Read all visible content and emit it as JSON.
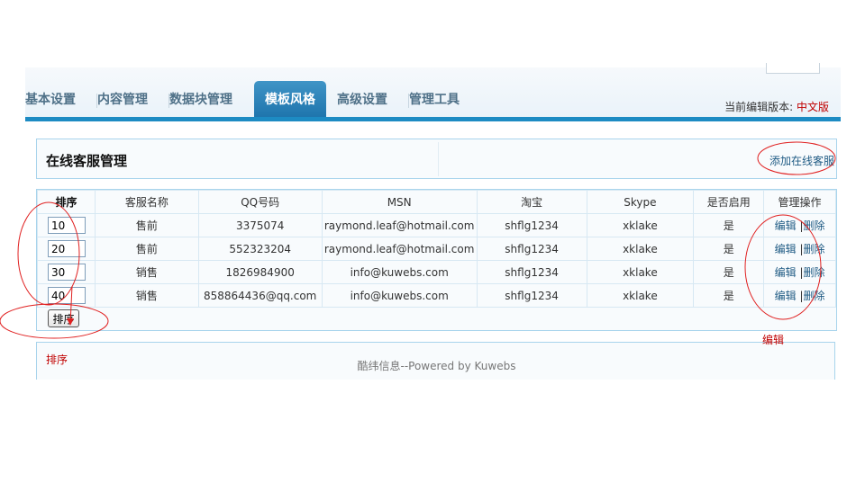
{
  "nav": {
    "items": [
      {
        "label": "基本设置",
        "active": false
      },
      {
        "label": "内容管理",
        "active": false
      },
      {
        "label": "数据块管理",
        "active": false
      },
      {
        "label": "模板风格",
        "active": true
      },
      {
        "label": "高级设置",
        "active": false
      },
      {
        "label": "管理工具",
        "active": false
      }
    ],
    "version_label": "当前编辑版本:",
    "version_value": "中文版"
  },
  "page": {
    "title": "在线客服管理",
    "add_link": "添加在线客服"
  },
  "table": {
    "headers": [
      "排序",
      "客服名称",
      "QQ号码",
      "MSN",
      "淘宝",
      "Skype",
      "是否启用",
      "管理操作"
    ],
    "rows": [
      {
        "order": "10",
        "name": "售前",
        "qq": "3375074",
        "msn": "raymond.leaf@hotmail.com",
        "taobao": "shflg1234",
        "skype": "xklake",
        "enabled": "是",
        "edit": "编辑",
        "sep": "|",
        "delete": "删除"
      },
      {
        "order": "20",
        "name": "售前",
        "qq": "552323204",
        "msn": "raymond.leaf@hotmail.com",
        "taobao": "shflg1234",
        "skype": "xklake",
        "enabled": "是",
        "edit": "编辑",
        "sep": "|",
        "delete": "删除"
      },
      {
        "order": "30",
        "name": "销售",
        "qq": "1826984900",
        "msn": "info@kuwebs.com",
        "taobao": "shflg1234",
        "skype": "xklake",
        "enabled": "是",
        "edit": "编辑",
        "sep": "|",
        "delete": "删除"
      },
      {
        "order": "40",
        "name": "销售",
        "qq": "858864436@qq.com",
        "msn": "info@kuwebs.com",
        "taobao": "shflg1234",
        "skype": "xklake",
        "enabled": "是",
        "edit": "编辑",
        "sep": "|",
        "delete": "删除"
      }
    ],
    "sort_button": "排序"
  },
  "footer": {
    "copyright": "酷纬信息--Powered by Kuwebs"
  },
  "annotations": {
    "sort_note": "排序",
    "edit_note": "编辑",
    "color": "#c00000"
  }
}
